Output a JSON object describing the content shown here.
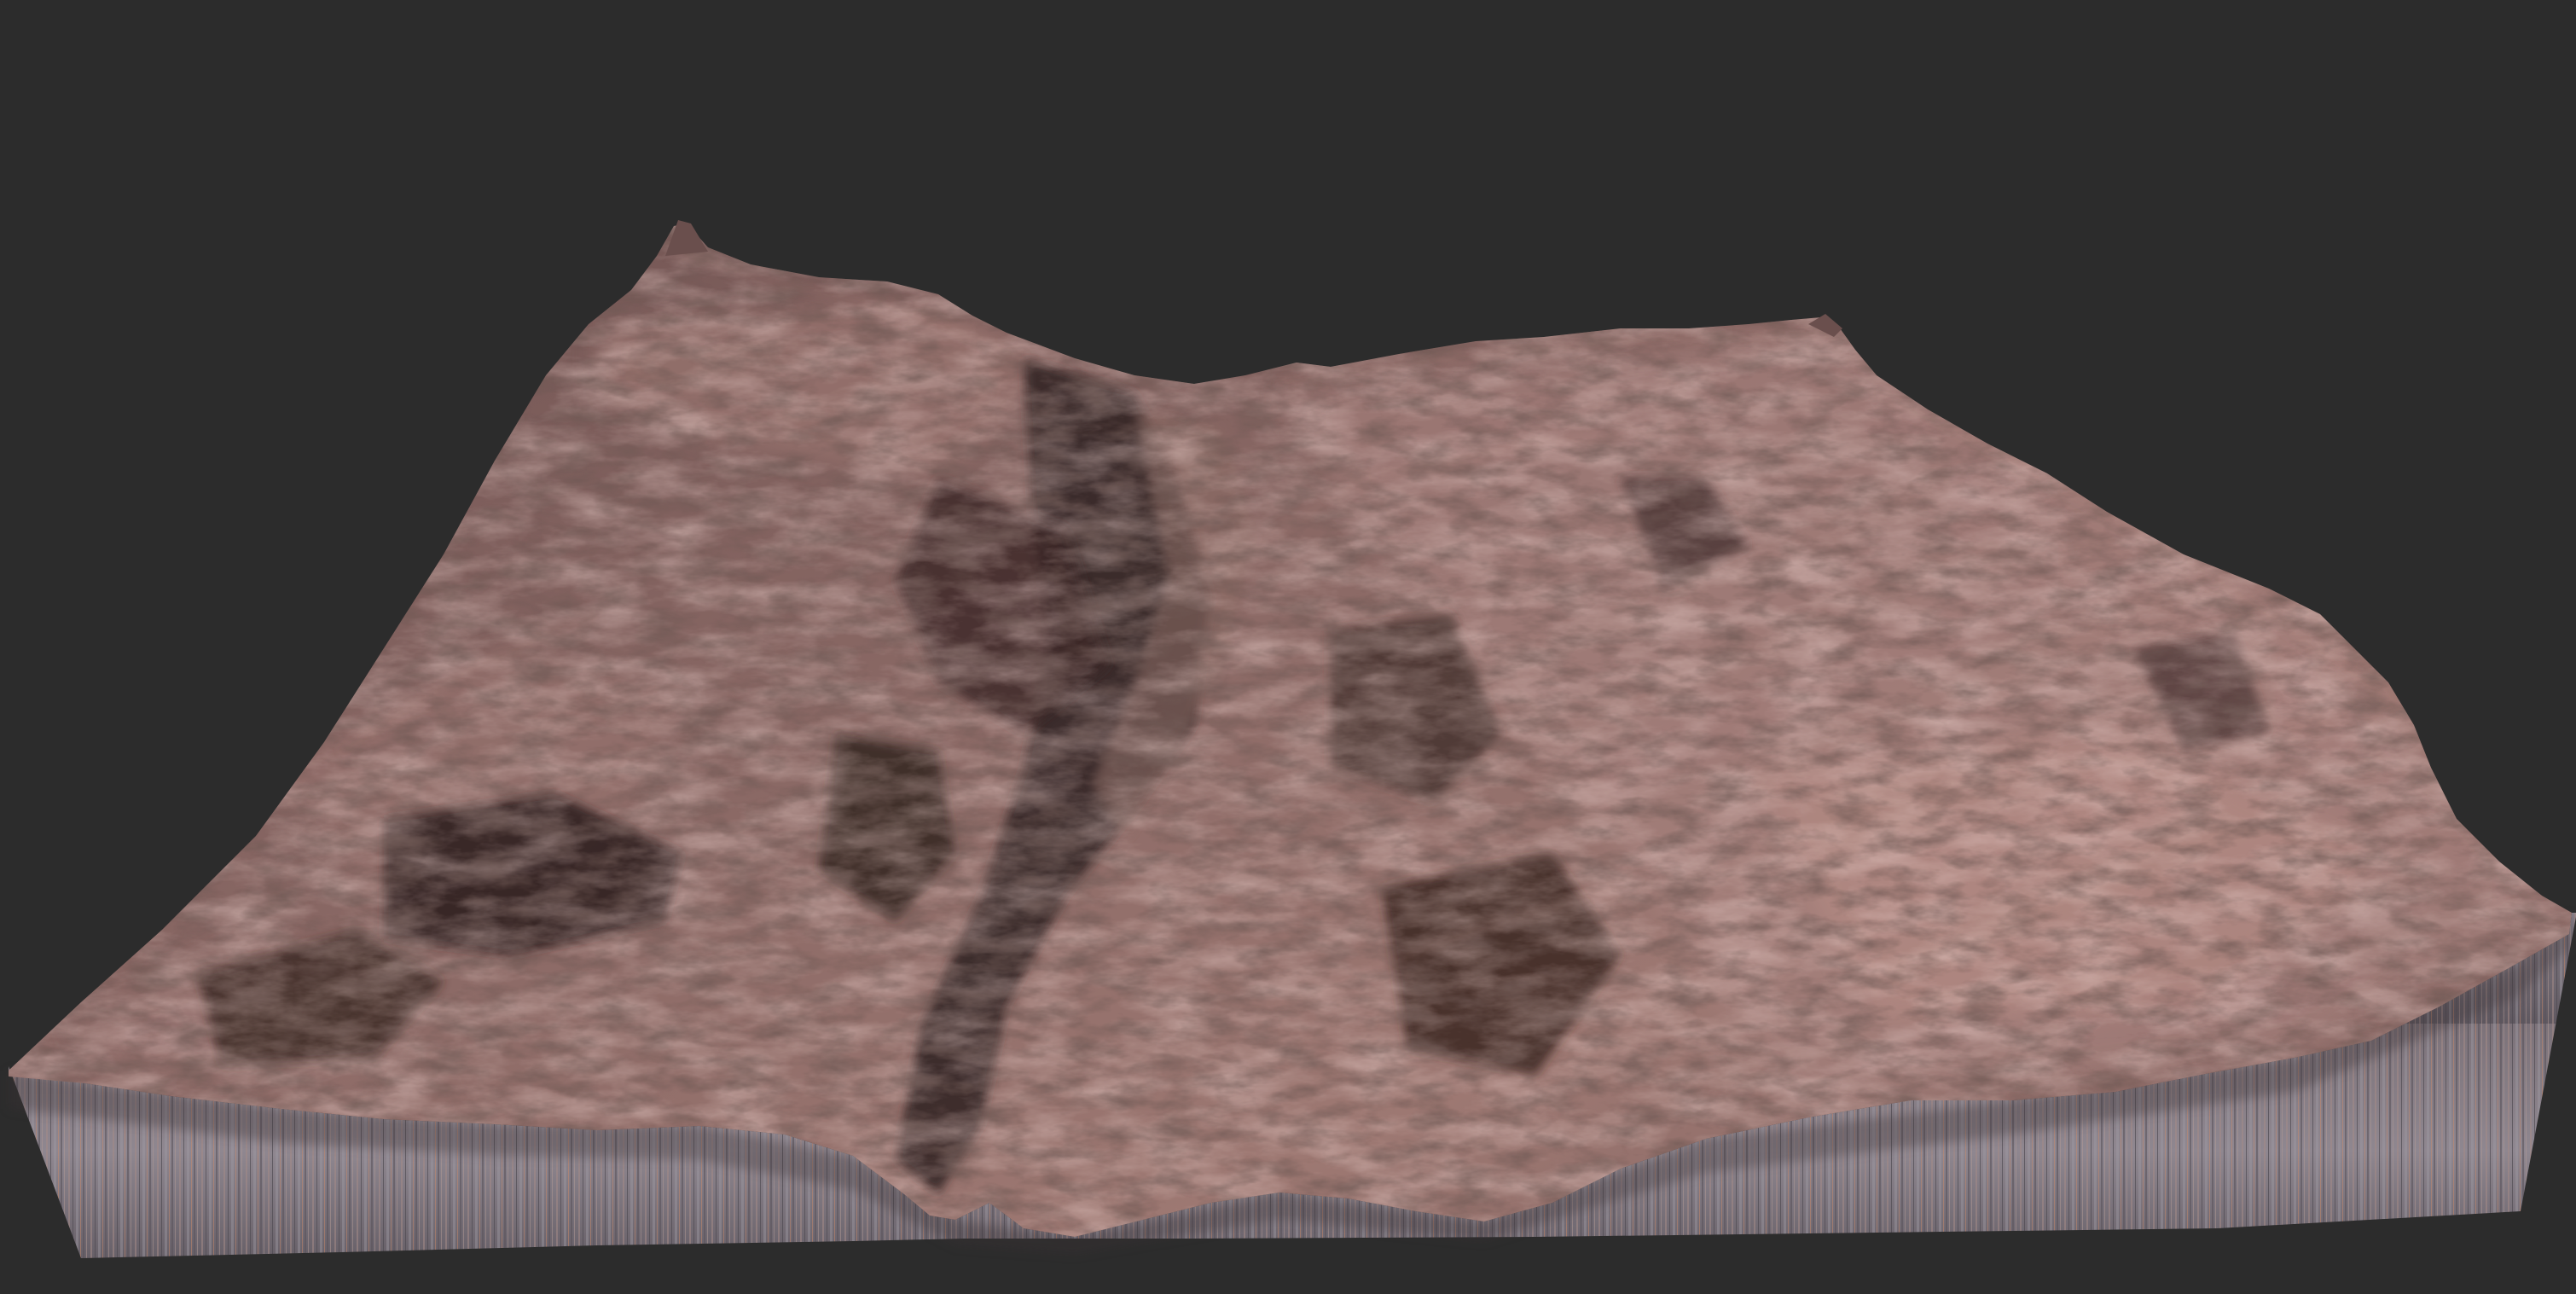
{
  "viewport": {
    "background_color": "#2c2c2c"
  },
  "terrain": {
    "description_icon": "terrain-mesh-icon",
    "colors": {
      "highlight": "#c99a8f",
      "lit_rock": "#a47c76",
      "mid_rock": "#7e5f5d",
      "shadow_rock": "#4a3533",
      "deep_shadow": "#2e201f",
      "skirt_light": "#8e8590",
      "skirt_mid": "#6f6770",
      "skirt_dark": "#4d4850",
      "skirt_accent": "#c98a6a"
    }
  }
}
